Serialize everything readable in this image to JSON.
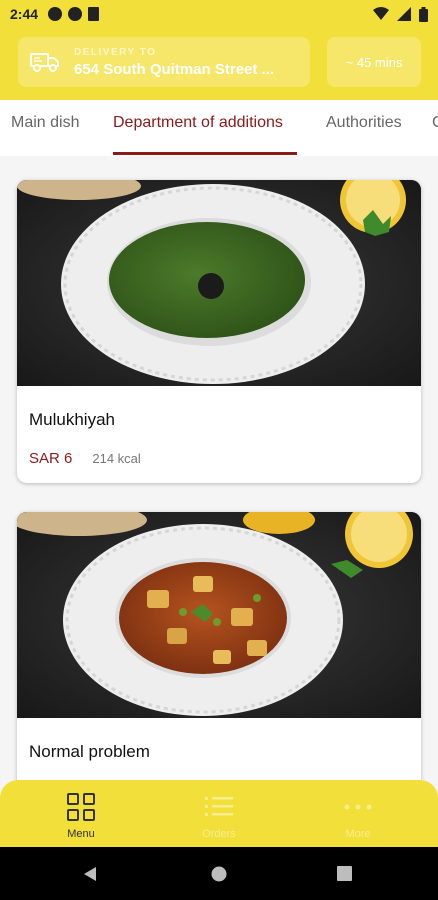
{
  "status_bar": {
    "time": "2:44"
  },
  "header": {
    "delivery_label": "DELIVERY TO",
    "delivery_address": "654 South Quitman Street ...",
    "eta": "~ 45 mins",
    "icon": "truck-icon"
  },
  "tabs": [
    {
      "label": "Main dish",
      "active": false
    },
    {
      "label": "Department of additions",
      "active": true
    },
    {
      "label": "Authorities",
      "active": false
    },
    {
      "label": "G",
      "active": false
    }
  ],
  "menu_items": [
    {
      "name": "Mulukhiyah",
      "price": "SAR 6",
      "kcal": "214 kcal"
    },
    {
      "name": "Normal problem",
      "price": "",
      "kcal": ""
    }
  ],
  "bottom_nav": [
    {
      "label": "Menu",
      "icon": "grid-icon",
      "active": true
    },
    {
      "label": "Orders",
      "icon": "list-icon",
      "active": false
    },
    {
      "label": "More",
      "icon": "more-dots-icon",
      "active": false
    }
  ],
  "colors": {
    "brand_yellow": "#f2df39",
    "accent_red": "#8b1a1a"
  }
}
